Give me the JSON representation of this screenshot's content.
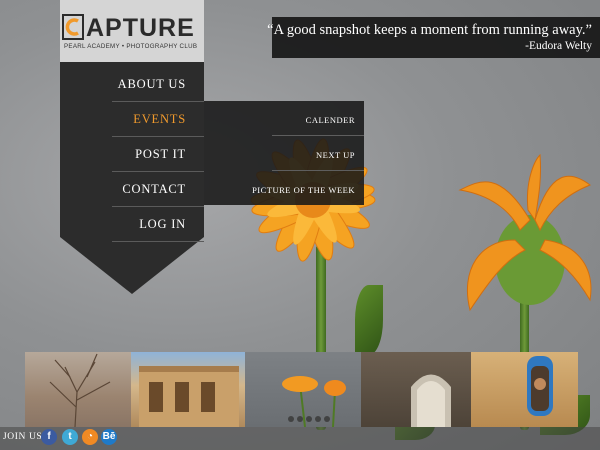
{
  "logo": {
    "word": "APTURE",
    "subtitle": "PEARL ACADEMY • PHOTOGRAPHY CLUB",
    "accent_color": "#f19a2c"
  },
  "nav": {
    "items": [
      {
        "label": "ABOUT US",
        "active": false
      },
      {
        "label": "EVENTS",
        "active": true
      },
      {
        "label": "POST IT",
        "active": false
      },
      {
        "label": "CONTACT",
        "active": false
      },
      {
        "label": "LOG IN",
        "active": false
      }
    ]
  },
  "submenu": {
    "items": [
      {
        "label": "CALENDER"
      },
      {
        "label": "NEXT UP"
      },
      {
        "label": "PICTURE OF THE WEEK"
      }
    ]
  },
  "quote": {
    "text": "“A good snapshot keeps a moment from running away.”",
    "author": "-Eudora Welty"
  },
  "gallery": {
    "thumbnails": [
      "dry-branches",
      "stone-temple",
      "orange-flowers",
      "stone-archway",
      "blue-window-child"
    ],
    "slides": 5,
    "active_slide": 0
  },
  "footer": {
    "join_label": "JOIN US",
    "social": [
      {
        "icon": "facebook-icon",
        "glyph": "f",
        "color": "#3b5ba0"
      },
      {
        "icon": "twitter-icon",
        "glyph": "t",
        "color": "#3fa9d5"
      },
      {
        "icon": "rss-icon",
        "glyph": "◔",
        "color": "#f08a24"
      },
      {
        "icon": "behance-icon",
        "glyph": "Bē",
        "color": "#1f7ac8"
      }
    ]
  }
}
